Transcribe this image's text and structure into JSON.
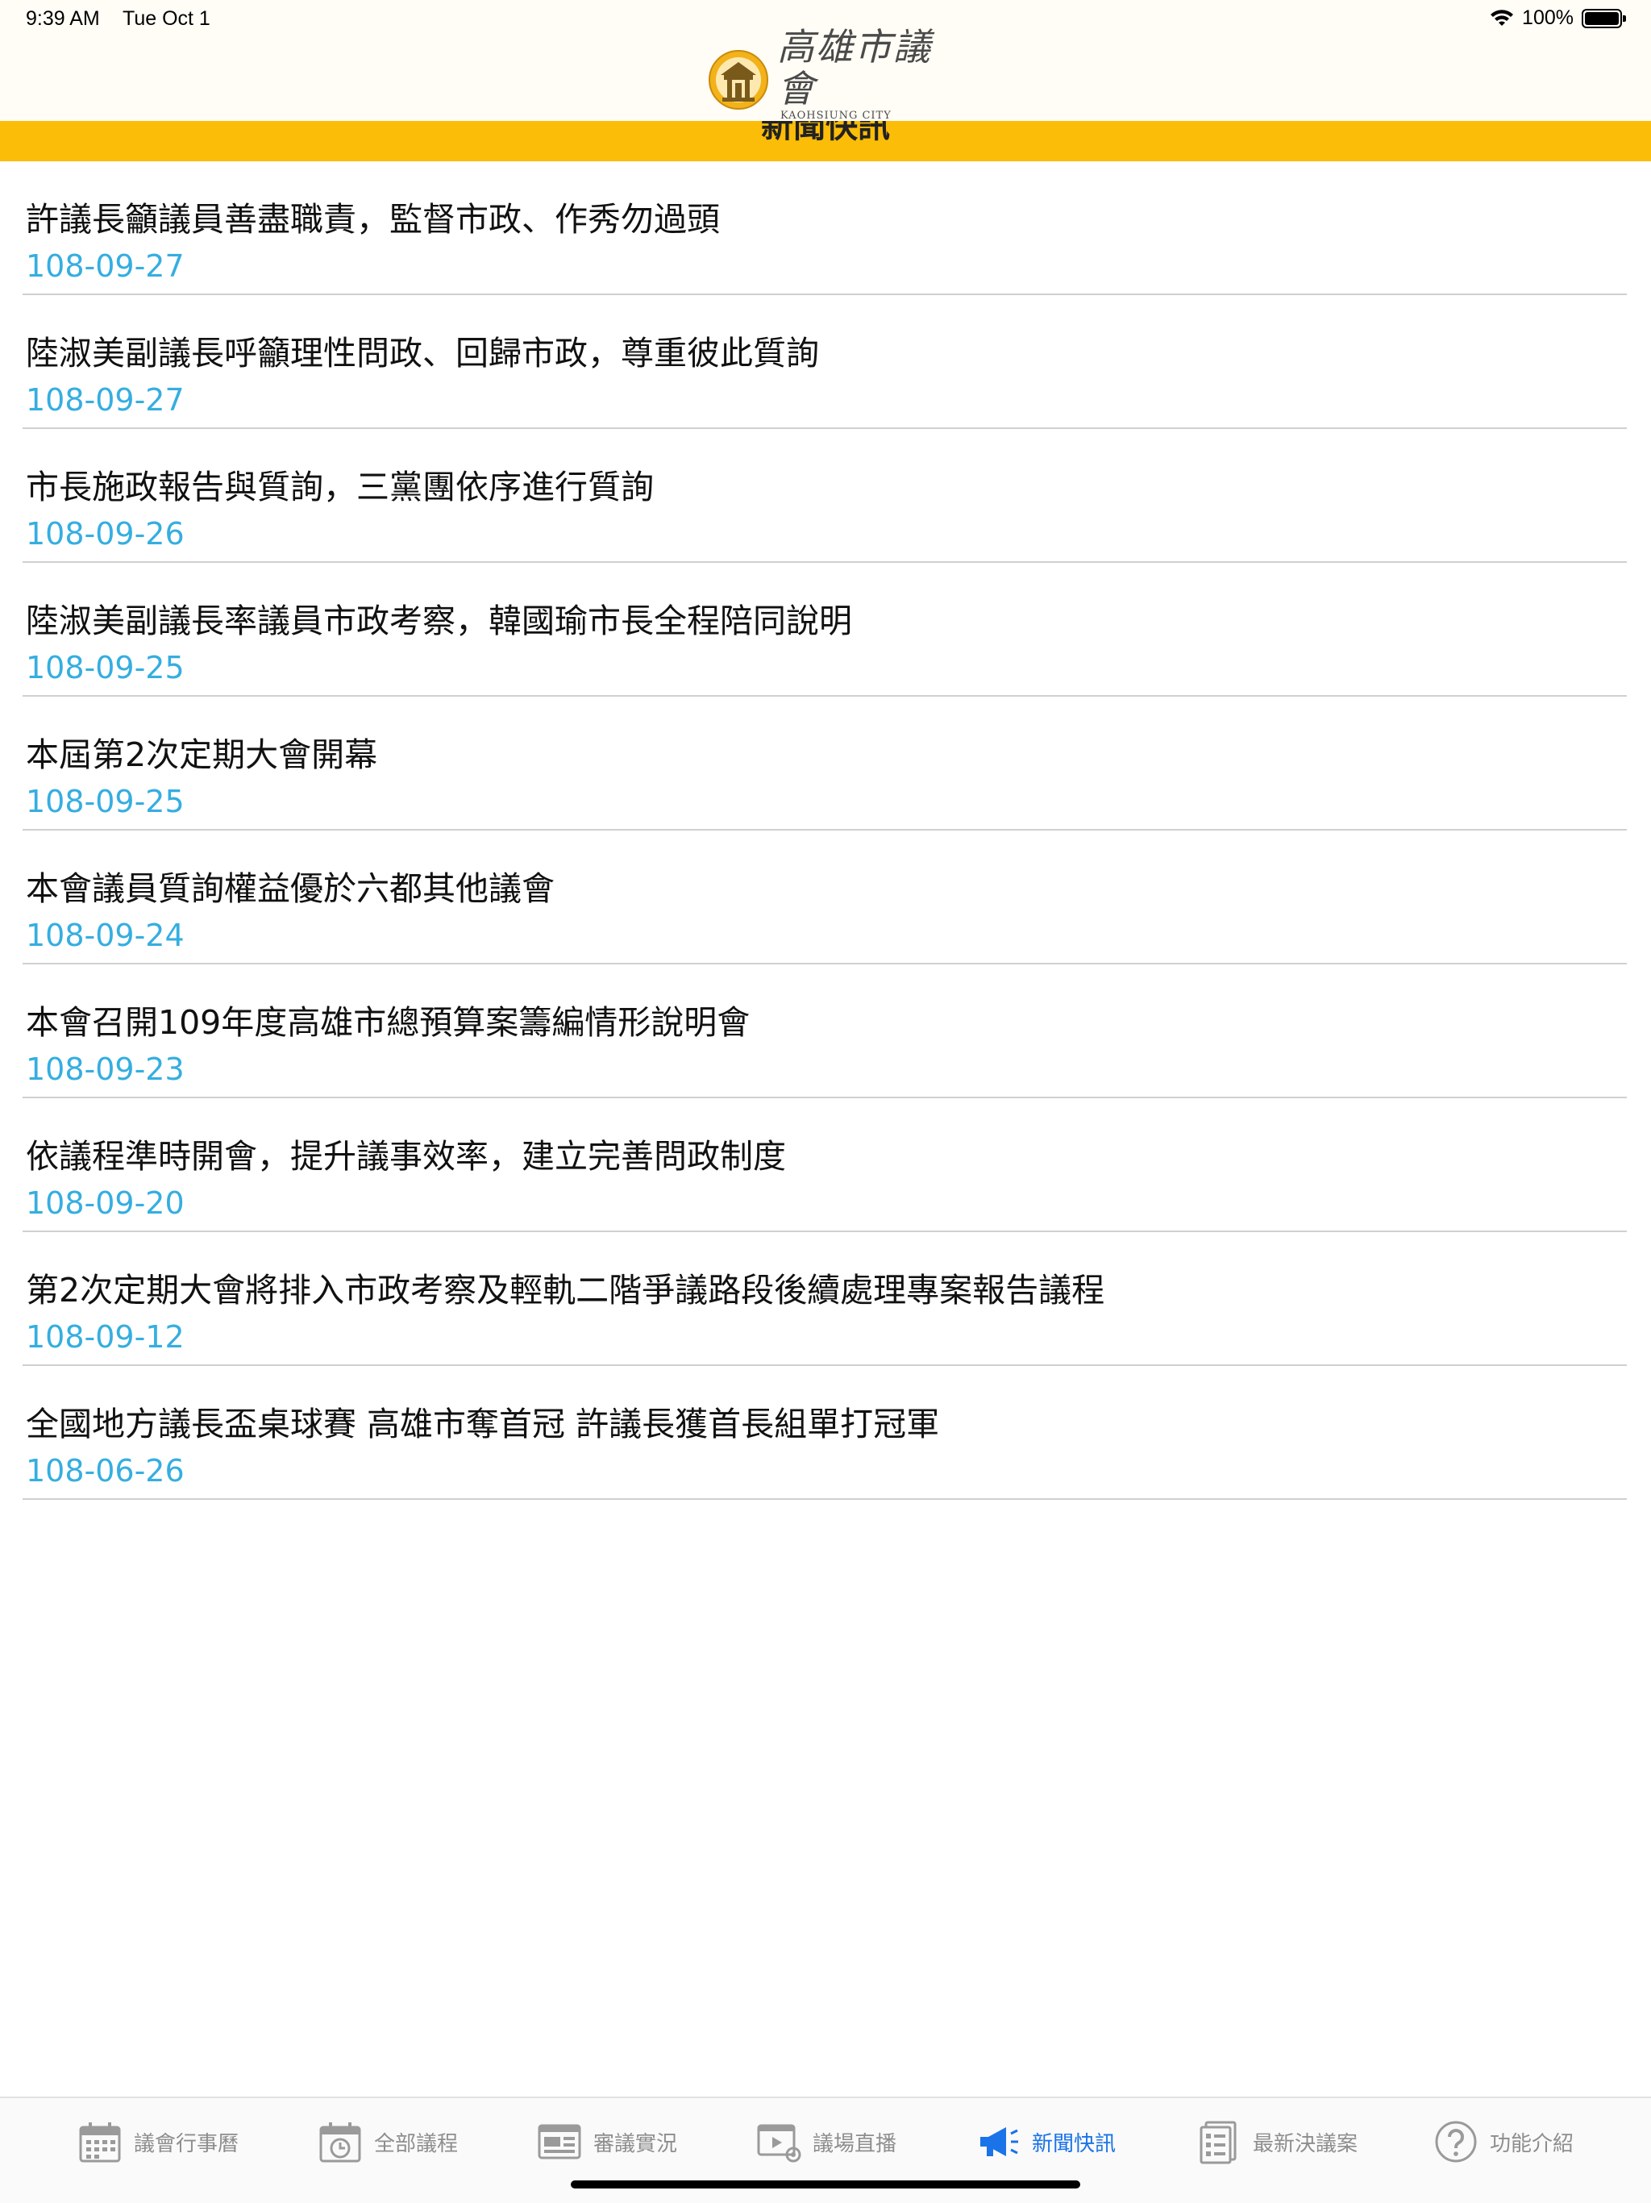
{
  "status_bar": {
    "time": "9:39 AM",
    "date": "Tue Oct 1",
    "battery": "100%"
  },
  "header": {
    "logo_title": "高雄市議會",
    "logo_subtitle": "KAOHSIUNG CITY COUNCIL"
  },
  "section": {
    "title": "新聞快訊"
  },
  "colors": {
    "accent_yellow": "#fbbd08",
    "date_blue": "#35aee0",
    "active_tab": "#1a73e8",
    "inactive_tab": "#8e8e8e"
  },
  "news": [
    {
      "title": "許議長籲議員善盡職責，監督市政、作秀勿過頭",
      "date": "108-09-27"
    },
    {
      "title": "陸淑美副議長呼籲理性問政、回歸市政，尊重彼此質詢",
      "date": "108-09-27"
    },
    {
      "title": "市長施政報告與質詢，三黨團依序進行質詢",
      "date": "108-09-26"
    },
    {
      "title": "陸淑美副議長率議員市政考察，韓國瑜市長全程陪同說明",
      "date": "108-09-25"
    },
    {
      "title": "本屆第2次定期大會開幕",
      "date": "108-09-25"
    },
    {
      "title": "本會議員質詢權益優於六都其他議會",
      "date": "108-09-24"
    },
    {
      "title": "本會召開109年度高雄市總預算案籌編情形說明會",
      "date": "108-09-23"
    },
    {
      "title": "依議程準時開會，提升議事效率，建立完善問政制度",
      "date": "108-09-20"
    },
    {
      "title": "第2次定期大會將排入市政考察及輕軌二階爭議路段後續處理專案報告議程",
      "date": "108-09-12"
    },
    {
      "title": "全國地方議長盃桌球賽 高雄市奪首冠 許議長獲首長組單打冠軍",
      "date": "108-06-26"
    }
  ],
  "tabs": [
    {
      "label": "議會行事曆",
      "icon": "calendar-icon"
    },
    {
      "label": "全部議程",
      "icon": "clock-calendar-icon"
    },
    {
      "label": "審議實況",
      "icon": "browser-window-icon"
    },
    {
      "label": "議場直播",
      "icon": "video-play-icon"
    },
    {
      "label": "新聞快訊",
      "icon": "megaphone-icon",
      "active": true
    },
    {
      "label": "最新決議案",
      "icon": "document-list-icon"
    },
    {
      "label": "功能介紹",
      "icon": "help-icon"
    }
  ]
}
